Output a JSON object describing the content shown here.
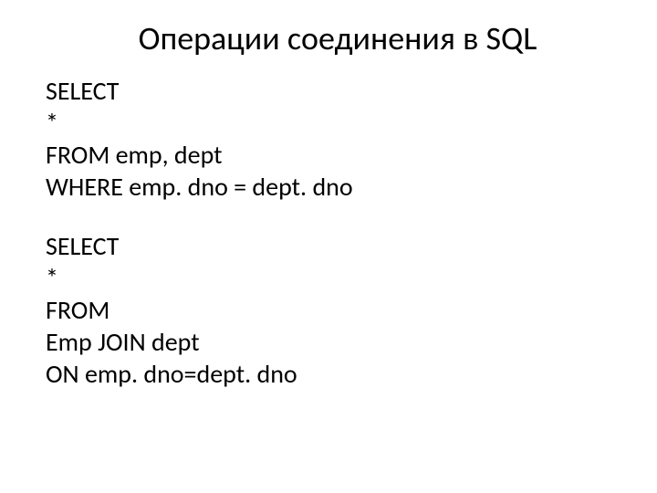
{
  "title": "Операции соединения в SQL",
  "block1": {
    "line1": "SELECT",
    "line2": "*",
    "line3": "FROM emp, dept",
    "line4": "WHERE emp. dno = dept. dno"
  },
  "block2": {
    "line1": "SELECT",
    "line2": "*",
    "line3": "FROM",
    "line4": "Emp JOIN dept",
    "line5": "ON emp. dno=dept. dno"
  }
}
